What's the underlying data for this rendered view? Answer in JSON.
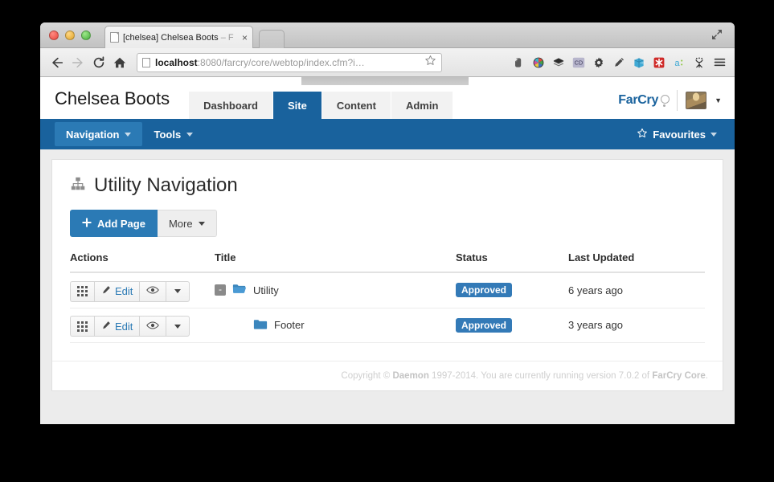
{
  "browser": {
    "tab_title_main": "[chelsea] Chelsea Boots",
    "tab_title_dim": " – F",
    "tab_close": "×",
    "url_host": "localhost",
    "url_rest": ":8080/farcry/core/webtop/index.cfm?i…",
    "extensions": [
      "evernote-icon",
      "color-wheel-icon",
      "layers-icon",
      "coda-icon",
      "gear-icon",
      "pencil-icon",
      "package-icon",
      "asterisk-icon",
      "adblock-icon",
      "wishbone-icon",
      "menu-icon"
    ]
  },
  "app": {
    "brand_title": "Chelsea Boots",
    "logo_text": "FarCry",
    "tabs": [
      {
        "label": "Dashboard",
        "active": false
      },
      {
        "label": "Site",
        "active": true
      },
      {
        "label": "Content",
        "active": false
      },
      {
        "label": "Admin",
        "active": false
      }
    ],
    "navbar": {
      "primary_menu": "Navigation",
      "secondary_menu": "Tools",
      "favourites": "Favourites"
    },
    "accent_blue": "#19629d",
    "button_blue": "#2b7ab5",
    "badge_blue": "#337ab7"
  },
  "page": {
    "title": "Utility Navigation",
    "title_icon": "sitemap-icon",
    "actions": {
      "add_page": "Add Page",
      "more": "More"
    },
    "table": {
      "columns": [
        "Actions",
        "Title",
        "Status",
        "Last Updated"
      ],
      "rows": [
        {
          "edit_label": "Edit",
          "expander": "-",
          "folder": "folder-open-icon",
          "indented": false,
          "title": "Utility",
          "status": "Approved",
          "last_updated": "6 years ago"
        },
        {
          "edit_label": "Edit",
          "expander": "",
          "folder": "folder-closed-icon",
          "indented": true,
          "title": "Footer",
          "status": "Approved",
          "last_updated": "3 years ago"
        }
      ]
    },
    "footer": {
      "prefix": "Copyright © ",
      "company": "Daemon",
      "middle": " 1997-2014. You are currently running version 7.0.2 of ",
      "product": "FarCry Core",
      "suffix": "."
    }
  }
}
